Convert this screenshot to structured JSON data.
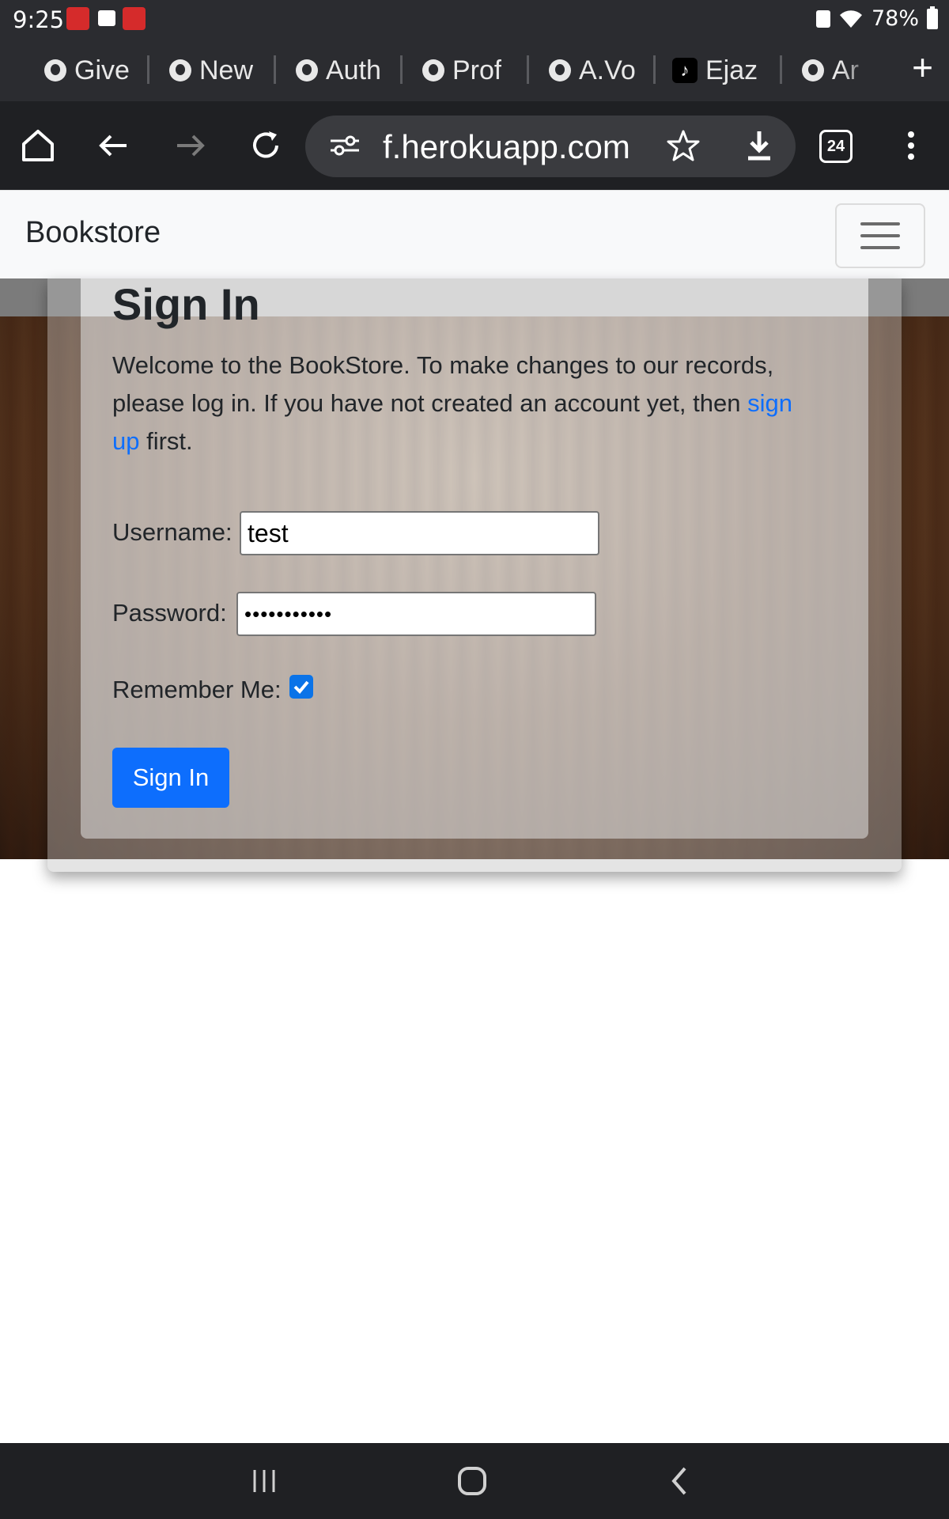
{
  "status_bar": {
    "time": "9:25",
    "battery": "78%"
  },
  "tabs": [
    {
      "label": "Give",
      "icon": "globe-icon"
    },
    {
      "label": "New",
      "icon": "chrome-icon"
    },
    {
      "label": "Auth",
      "icon": "globe-icon"
    },
    {
      "label": "Prof",
      "icon": "globe-icon"
    },
    {
      "label": "A.Vo",
      "icon": "globe-icon"
    },
    {
      "label": "Ejaz",
      "icon": "tiktok-icon"
    },
    {
      "label": "Ar",
      "icon": "globe-icon"
    }
  ],
  "toolbar": {
    "url": "f.herokuapp.com",
    "tab_count": "24"
  },
  "navbar": {
    "brand": "Bookstore"
  },
  "signin": {
    "title": "Sign In",
    "intro_before": "Welcome to the BookStore. To make changes to our records, please log in. If you have not created an account yet, then ",
    "signup_link": "sign up",
    "intro_after": " first.",
    "username_label": "Username:",
    "username_value": "test",
    "password_label": "Password:",
    "password_value": "•••••••••••",
    "remember_label": "Remember Me:",
    "remember_checked": true,
    "submit_label": "Sign In"
  },
  "colors": {
    "primary": "#0d6efd",
    "link": "#0d6efd",
    "browser_chrome": "#1f2023"
  }
}
